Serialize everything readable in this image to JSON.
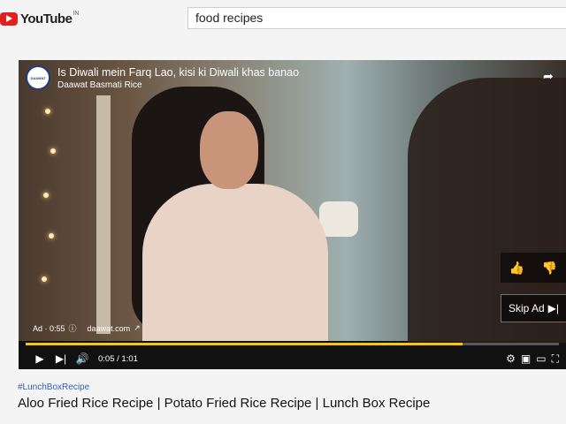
{
  "header": {
    "logo_text": "YouTube",
    "country": "IN",
    "search_value": "food recipes"
  },
  "ad": {
    "title": "Is Diwali mein Farq Lao, kisi ki Diwali khas banao",
    "brand": "Daawat Basmati Rice",
    "logo_text": "DAAWAT",
    "label": "Ad · 0:55",
    "domain": "daawat.com",
    "skip_label": "Skip Ad",
    "progress": 0.82
  },
  "player": {
    "time": "0:05 / 1:01"
  },
  "video": {
    "hashtag": "#LunchBoxRecipe",
    "title": "Aloo Fried Rice Recipe | Potato Fried Rice Recipe | Lunch Box Recipe"
  },
  "icons": {
    "share": "share-icon",
    "like": "thumbs-up-icon",
    "dislike": "thumbs-down-icon"
  },
  "colors": {
    "progress": "#f5c518",
    "brand": "#e02020"
  }
}
